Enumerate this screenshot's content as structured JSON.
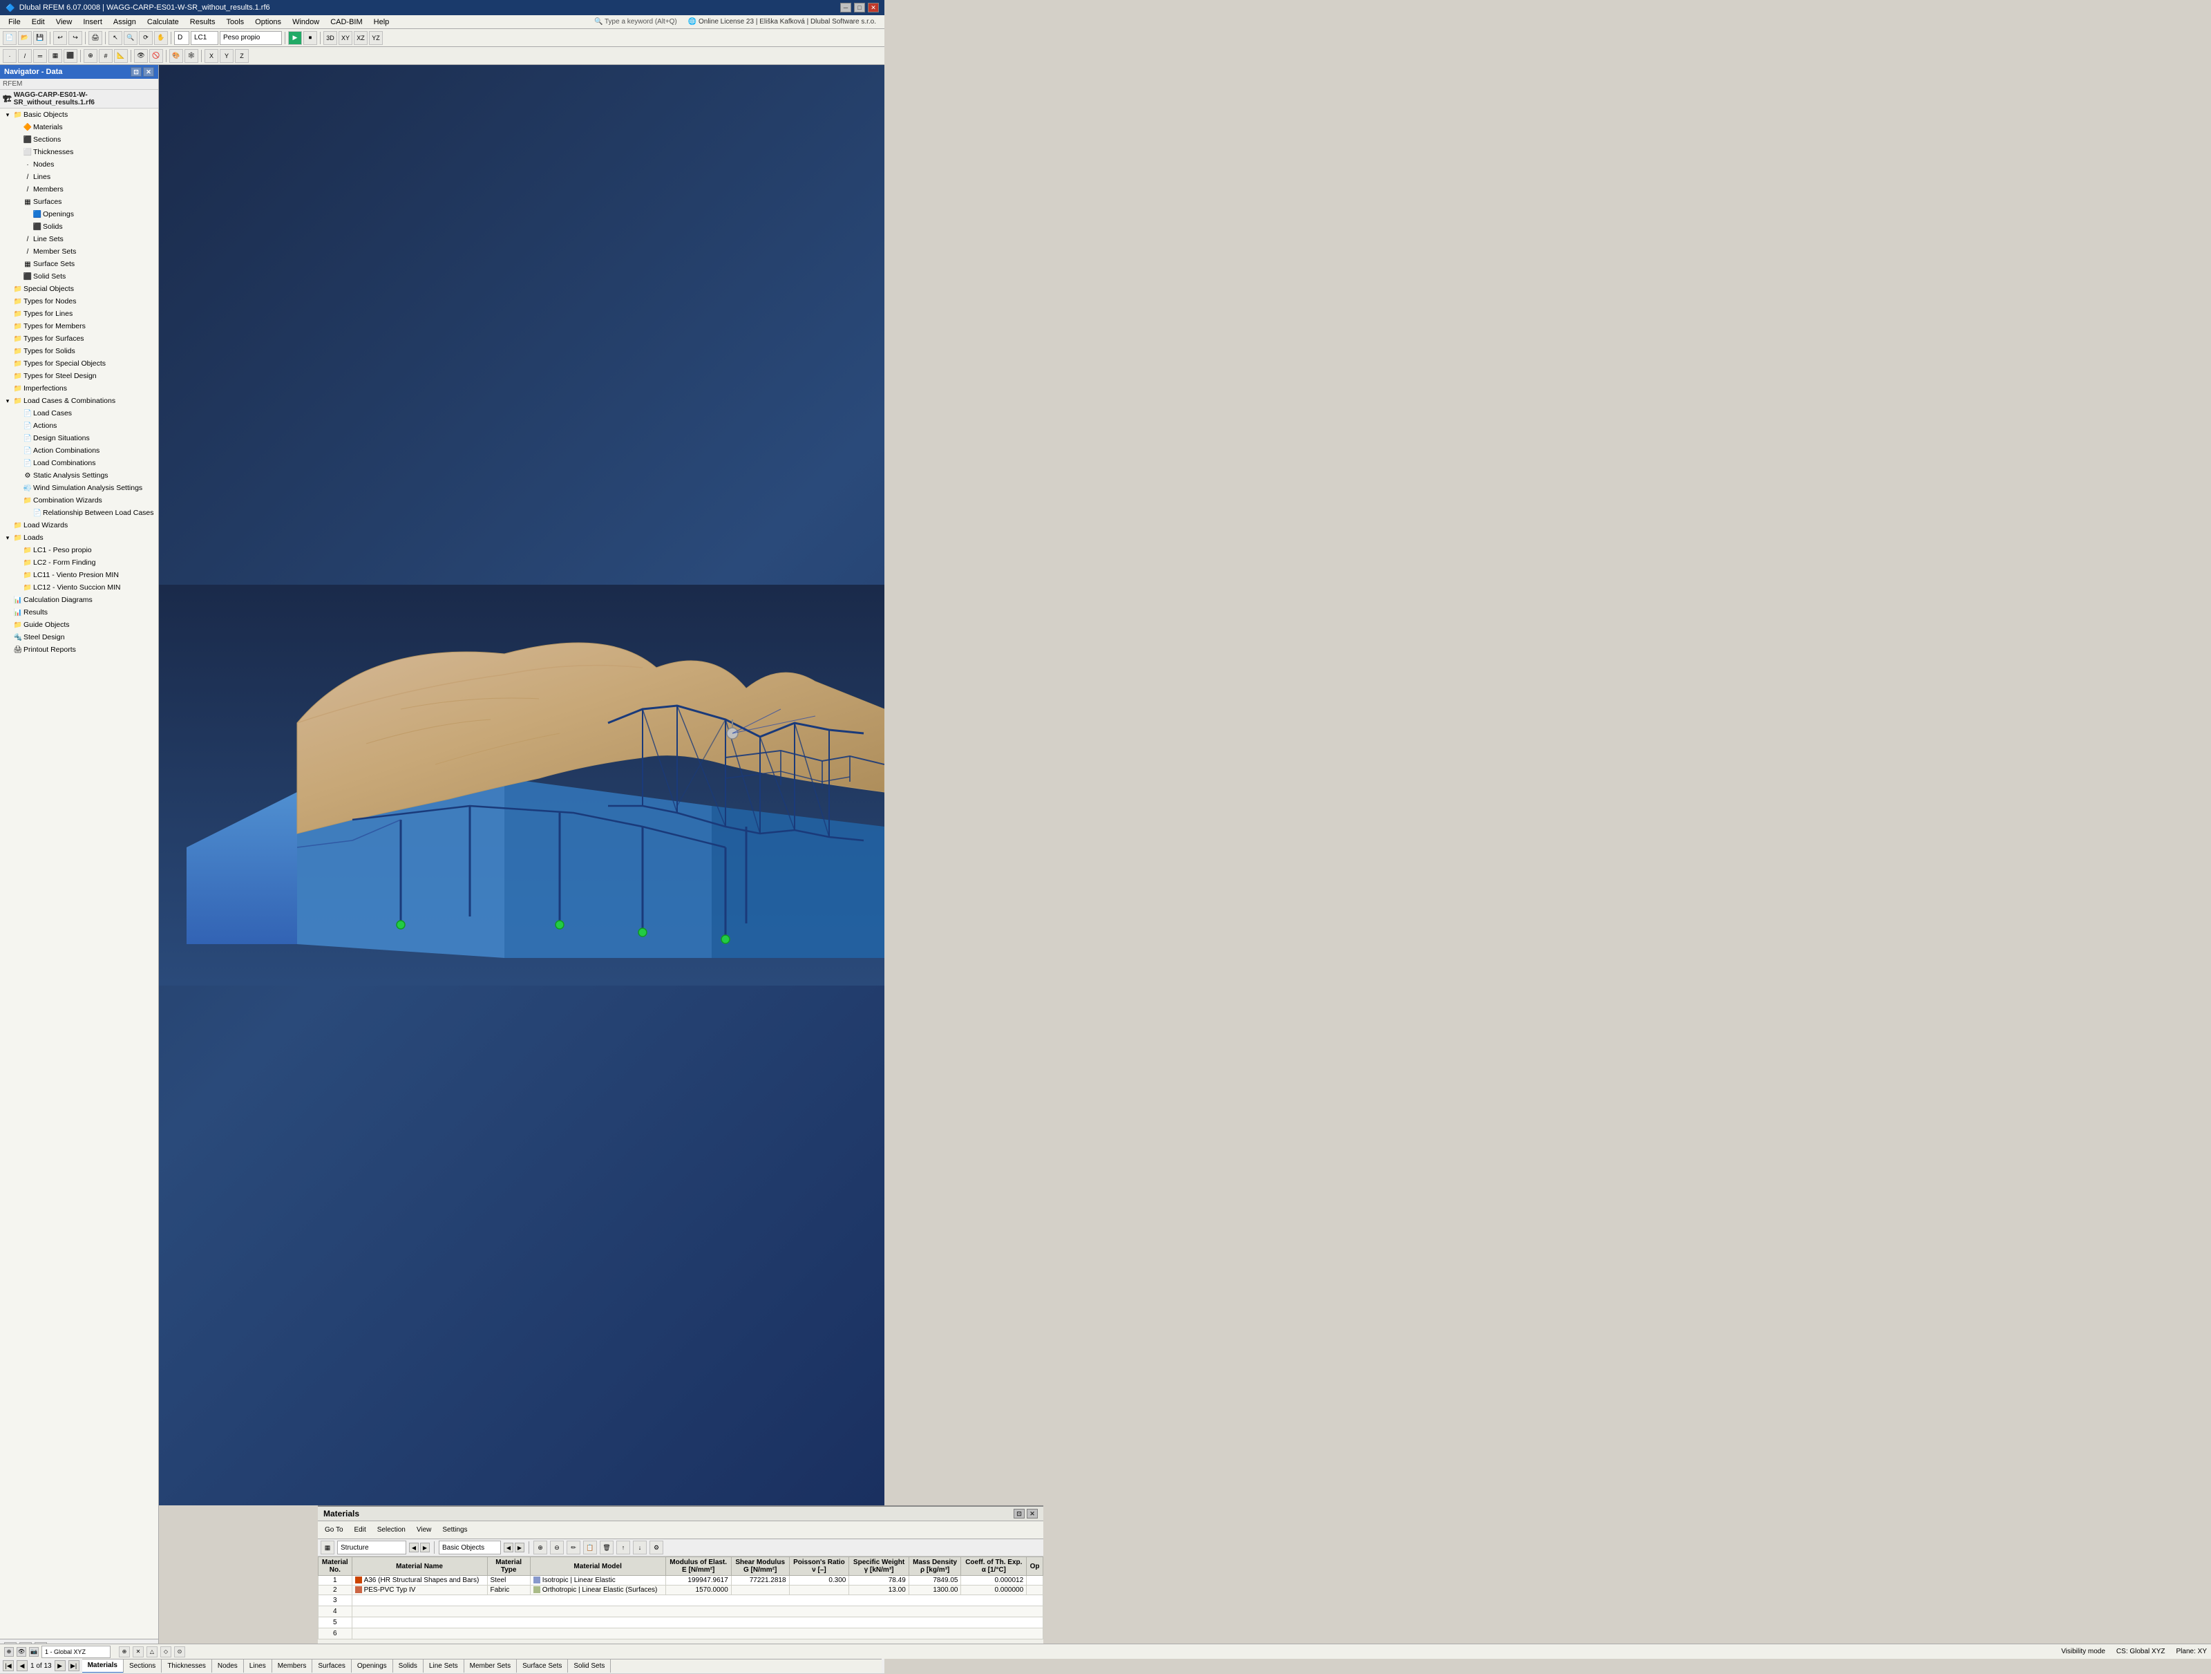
{
  "window": {
    "title": "Dlubal RFEM  6.07.0008 | WAGG-CARP-ES01-W-SR_without_results.1.rf6",
    "logo": "🔷"
  },
  "menubar": {
    "items": [
      "File",
      "Edit",
      "View",
      "Insert",
      "Assign",
      "Calculate",
      "Results",
      "Tools",
      "Options",
      "Window",
      "CAD-BIM",
      "Help"
    ]
  },
  "navigator": {
    "title": "Navigator - Data",
    "rfem_label": "RFEM",
    "file_label": "WAGG-CARP-ES01-W-SR_without_results.1.rf6",
    "tree": [
      {
        "id": "basic-objects",
        "label": "Basic Objects",
        "level": 1,
        "expanded": true,
        "icon": "📁"
      },
      {
        "id": "materials",
        "label": "Materials",
        "level": 2,
        "icon": "🔶"
      },
      {
        "id": "sections",
        "label": "Sections",
        "level": 2,
        "icon": "⬛"
      },
      {
        "id": "thicknesses",
        "label": "Thicknesses",
        "level": 2,
        "icon": "⬛"
      },
      {
        "id": "nodes",
        "label": "Nodes",
        "level": 2,
        "icon": "·"
      },
      {
        "id": "lines",
        "label": "Lines",
        "level": 2,
        "icon": "/"
      },
      {
        "id": "members",
        "label": "Members",
        "level": 2,
        "icon": "/"
      },
      {
        "id": "surfaces",
        "label": "Surfaces",
        "level": 2,
        "icon": "▦"
      },
      {
        "id": "openings",
        "label": "Openings",
        "level": 3,
        "icon": "🟦"
      },
      {
        "id": "solids",
        "label": "Solids",
        "level": 3,
        "icon": "⬛"
      },
      {
        "id": "line-sets",
        "label": "Line Sets",
        "level": 2,
        "icon": "/"
      },
      {
        "id": "member-sets",
        "label": "Member Sets",
        "level": 2,
        "icon": "/"
      },
      {
        "id": "surface-sets",
        "label": "Surface Sets",
        "level": 2,
        "icon": "▦"
      },
      {
        "id": "solid-sets",
        "label": "Solid Sets",
        "level": 2,
        "icon": "⬛"
      },
      {
        "id": "special-objects",
        "label": "Special Objects",
        "level": 1,
        "icon": "📁"
      },
      {
        "id": "types-nodes",
        "label": "Types for Nodes",
        "level": 1,
        "icon": "📁"
      },
      {
        "id": "types-lines",
        "label": "Types for Lines",
        "level": 1,
        "icon": "📁"
      },
      {
        "id": "types-members",
        "label": "Types for Members",
        "level": 1,
        "icon": "📁"
      },
      {
        "id": "types-surfaces",
        "label": "Types for Surfaces",
        "level": 1,
        "icon": "📁"
      },
      {
        "id": "types-solids",
        "label": "Types for Solids",
        "level": 1,
        "icon": "📁"
      },
      {
        "id": "types-special",
        "label": "Types for Special Objects",
        "level": 1,
        "icon": "📁"
      },
      {
        "id": "types-steel",
        "label": "Types for Steel Design",
        "level": 1,
        "icon": "📁"
      },
      {
        "id": "imperfections",
        "label": "Imperfections",
        "level": 1,
        "icon": "📁"
      },
      {
        "id": "load-cases-combinations",
        "label": "Load Cases & Combinations",
        "level": 1,
        "expanded": true,
        "icon": "📁"
      },
      {
        "id": "load-cases",
        "label": "Load Cases",
        "level": 2,
        "icon": "📄"
      },
      {
        "id": "actions",
        "label": "Actions",
        "level": 2,
        "icon": "📄"
      },
      {
        "id": "design-situations",
        "label": "Design Situations",
        "level": 2,
        "icon": "📄"
      },
      {
        "id": "action-combinations",
        "label": "Action Combinations",
        "level": 2,
        "icon": "📄"
      },
      {
        "id": "load-combinations",
        "label": "Load Combinations",
        "level": 2,
        "icon": "📄"
      },
      {
        "id": "static-analysis",
        "label": "Static Analysis Settings",
        "level": 2,
        "icon": "📄"
      },
      {
        "id": "wind-simulation",
        "label": "Wind Simulation Analysis Settings",
        "level": 2,
        "icon": "📄"
      },
      {
        "id": "combination-wizards",
        "label": "Combination Wizards",
        "level": 2,
        "icon": "📁"
      },
      {
        "id": "relationship-load-cases",
        "label": "Relationship Between Load Cases",
        "level": 3,
        "icon": "📄"
      },
      {
        "id": "load-wizards",
        "label": "Load Wizards",
        "level": 1,
        "icon": "📁"
      },
      {
        "id": "loads",
        "label": "Loads",
        "level": 1,
        "expanded": true,
        "icon": "📁"
      },
      {
        "id": "lc1",
        "label": "LC1 - Peso propio",
        "level": 2,
        "icon": "📁"
      },
      {
        "id": "lc2",
        "label": "LC2 - Form Finding",
        "level": 2,
        "icon": "📁"
      },
      {
        "id": "lc11",
        "label": "LC11 - Viento Presion MIN",
        "level": 2,
        "icon": "📁"
      },
      {
        "id": "lc12",
        "label": "LC12 - Viento Succion MIN",
        "level": 2,
        "icon": "📁"
      },
      {
        "id": "calculation-diagrams",
        "label": "Calculation Diagrams",
        "level": 1,
        "icon": "📁"
      },
      {
        "id": "results",
        "label": "Results",
        "level": 1,
        "icon": "📁"
      },
      {
        "id": "guide-objects",
        "label": "Guide Objects",
        "level": 1,
        "icon": "📁"
      },
      {
        "id": "steel-design",
        "label": "Steel Design",
        "level": 1,
        "icon": "📁"
      },
      {
        "id": "printout-reports",
        "label": "Printout Reports",
        "level": 1,
        "icon": "📁"
      }
    ]
  },
  "toolbar1": {
    "lc_label": "LC1",
    "lc_name": "Peso propio"
  },
  "materials_panel": {
    "title": "Materials",
    "menus": [
      "Go To",
      "Edit",
      "Selection",
      "View",
      "Settings"
    ],
    "filter_label": "Structure",
    "filter2_label": "Basic Objects",
    "columns": [
      "Material No.",
      "Material Name",
      "Material Type",
      "Material Model",
      "Modulus of Elast. E [N/mm²]",
      "Shear Modulus G [N/mm²]",
      "Poisson's Ratio ν [–]",
      "Specific Weight γ [kN/m³]",
      "Mass Density ρ [kg/m³]",
      "Coeff. of Th. Exp. α [1/°C]",
      "Op"
    ],
    "rows": [
      {
        "no": "1",
        "name": "A36 (HR Structural Shapes and Bars)",
        "color": "#cc4400",
        "type": "Steel",
        "model": "Isotropic | Linear Elastic",
        "model_color": "#8899cc",
        "E": "199947.9617",
        "G": "77221.2818",
        "nu": "0.300",
        "gamma": "78.49",
        "rho": "7849.05",
        "alpha": "0.000012"
      },
      {
        "no": "2",
        "name": "PES-PVC Typ IV",
        "color": "#cc6644",
        "type": "Fabric",
        "model": "Orthotropic | Linear Elastic (Surfaces)",
        "model_color": "#aabb88",
        "E": "1570.0000",
        "G": "",
        "nu": "",
        "gamma": "13.00",
        "rho": "1300.00",
        "alpha": "0.000000"
      }
    ],
    "empty_rows": [
      "3",
      "4",
      "5",
      "6"
    ]
  },
  "tabs": {
    "page_info": "1 of 13",
    "items": [
      "Materials",
      "Sections",
      "Thicknesses",
      "Nodes",
      "Lines",
      "Members",
      "Surfaces",
      "Openings",
      "Solids",
      "Line Sets",
      "Member Sets",
      "Surface Sets",
      "Solid Sets"
    ]
  },
  "statusbar": {
    "global_xyz": "1 - Global XYZ",
    "visibility": "Visibility mode",
    "cs": "CS: Global XYZ",
    "plane": "Plane: XY"
  }
}
